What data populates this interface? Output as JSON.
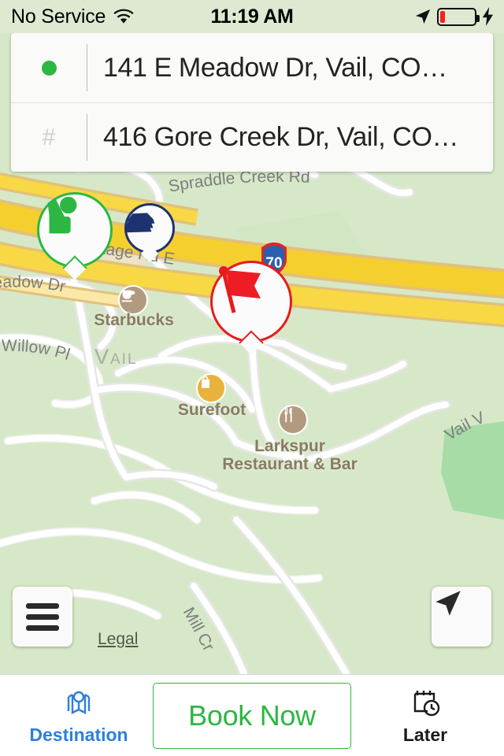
{
  "status_bar": {
    "carrier": "No Service",
    "wifi_icon": "wifi-icon",
    "time": "11:19 AM",
    "location_icon": "location-arrow-icon",
    "battery_icon": "battery-low-icon",
    "battery_level_pct": 15,
    "battery_color": "#f3231f",
    "charging_icon": "lightning-bolt-icon"
  },
  "address_card": {
    "pickup": {
      "icon": "green-dot-icon",
      "icon_color": "#2cb742",
      "text": "141 E Meadow Dr, Vail, CO…"
    },
    "destination": {
      "icon": "hash-icon",
      "text": "416 Gore Creek Dr, Vail, CO…"
    }
  },
  "map": {
    "background_color": "#d7e8c8",
    "highway_color": "#f5cf2e",
    "pins": [
      {
        "name": "pickup-pin",
        "icon": "hailing-person-icon",
        "color": "#2cb742"
      },
      {
        "name": "vehicle-pin",
        "icon": "car-fleet-icon",
        "color": "#1f3270"
      },
      {
        "name": "destination-pin",
        "icon": "red-flag-icon",
        "color": "#e81b1b"
      }
    ],
    "pois": [
      {
        "name": "starbucks",
        "label": "Starbucks",
        "icon": "coffee-cup-icon"
      },
      {
        "name": "surefoot",
        "label": "Surefoot",
        "icon": "shopping-bag-icon"
      },
      {
        "name": "larkspur",
        "label": "Larkspur\nRestaurant & Bar",
        "icon": "restaurant-icon"
      }
    ],
    "city_label": "Vail",
    "road_labels": [
      "Spraddle Creek Rd",
      "tage Rd E",
      "eadow Dr",
      "Willow Pl",
      "Mill Cr",
      "Vail V"
    ],
    "highway_shield": "70",
    "legal_link": "Legal",
    "menu_button_icon": "hamburger-menu-icon",
    "locate_button_icon": "navigation-arrow-icon"
  },
  "bottom_bar": {
    "destination_tab": {
      "label": "Destination",
      "icon": "map-pin-fold-icon",
      "color": "#2d7fe0"
    },
    "book_now": {
      "label": "Book Now",
      "color": "#2cb742"
    },
    "later_tab": {
      "label": "Later",
      "icon": "calendar-clock-icon",
      "color": "#1a1a1a"
    }
  }
}
